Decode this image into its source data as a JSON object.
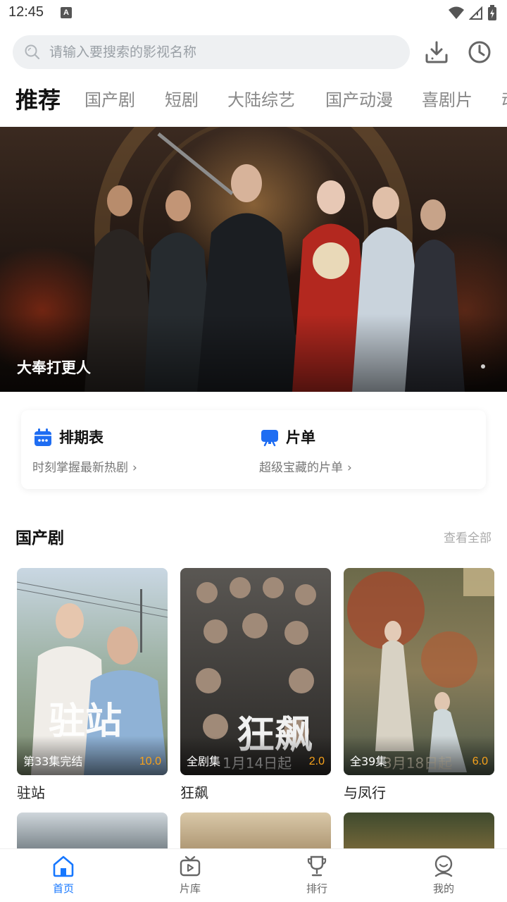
{
  "status_bar": {
    "time": "12:45",
    "notification_glyph": "A"
  },
  "header": {
    "search": {
      "placeholder": "请输入要搜索的影视名称"
    },
    "download_icon": "download-icon",
    "history_icon": "clock-icon"
  },
  "tabs": [
    {
      "label": "推荐",
      "active": true
    },
    {
      "label": "国产剧",
      "active": false
    },
    {
      "label": "短剧",
      "active": false
    },
    {
      "label": "大陆综艺",
      "active": false
    },
    {
      "label": "国产动漫",
      "active": false
    },
    {
      "label": "喜剧片",
      "active": false
    },
    {
      "label": "动",
      "active": false
    }
  ],
  "banner": {
    "title": "大奉打更人",
    "pages": 1,
    "current_page": 1
  },
  "quick_links": [
    {
      "title": "排期表",
      "subtitle": "时刻掌握最新热剧",
      "icon": "calendar-icon"
    },
    {
      "title": "片单",
      "subtitle": "超级宝藏的片单",
      "icon": "playlist-board-icon"
    }
  ],
  "section": {
    "title": "国产剧",
    "more_label": "查看全部",
    "items": [
      {
        "name": "驻站",
        "episodes": "第33集完结",
        "score": "10.0"
      },
      {
        "name": "狂飙",
        "episodes": "全剧集",
        "score": "2.0"
      },
      {
        "name": "与凤行",
        "episodes": "全39集",
        "score": "6.0"
      }
    ]
  },
  "bottom_nav": [
    {
      "label": "首页",
      "icon": "home-icon",
      "active": true
    },
    {
      "label": "片库",
      "icon": "tv-icon",
      "active": false
    },
    {
      "label": "排行",
      "icon": "trophy-icon",
      "active": false
    },
    {
      "label": "我的",
      "icon": "user-icon",
      "active": false
    }
  ],
  "colors": {
    "accent": "#1677ff",
    "score": "#f7a21b",
    "search_bg": "#eef0f2"
  }
}
